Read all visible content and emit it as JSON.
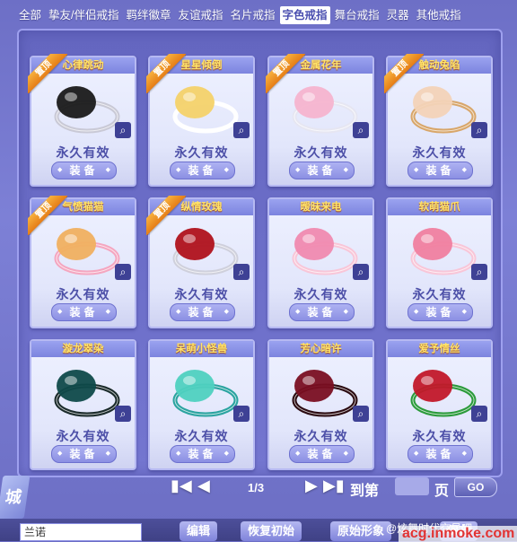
{
  "tabs": [
    {
      "label": "全部",
      "active": false
    },
    {
      "label": "挚友/伴侣戒指",
      "active": false
    },
    {
      "label": "羁绊徽章",
      "active": false
    },
    {
      "label": "友谊戒指",
      "active": false
    },
    {
      "label": "名片戒指",
      "active": false
    },
    {
      "label": "字色戒指",
      "active": true
    },
    {
      "label": "舞台戒指",
      "active": false
    },
    {
      "label": "灵器",
      "active": false
    },
    {
      "label": "其他戒指",
      "active": false
    }
  ],
  "ribbon_label": "置顶",
  "items": [
    {
      "name": "心律跳动",
      "pinned": true,
      "validity": "永久有效",
      "button": "装备",
      "icon": "black-heart-ring-icon",
      "colors": [
        "#1a1a1a",
        "#c9c9d6"
      ]
    },
    {
      "name": "星星倾倒",
      "pinned": true,
      "validity": "永久有效",
      "button": "装备",
      "icon": "golden-star-ring-icon",
      "colors": [
        "#f4d26a",
        "#ffffff"
      ]
    },
    {
      "name": "金属花年",
      "pinned": true,
      "validity": "永久有效",
      "button": "装备",
      "icon": "pink-flower-ring-icon",
      "colors": [
        "#f6b4cf",
        "#e6e6f2"
      ]
    },
    {
      "name": "触动兔陷",
      "pinned": true,
      "validity": "永久有效",
      "button": "装备",
      "icon": "bunny-ring-icon",
      "colors": [
        "#f3d3b8",
        "#d8a66a"
      ]
    },
    {
      "name": "气愤猫猫",
      "pinned": true,
      "validity": "永久有效",
      "button": "装备",
      "icon": "angry-cat-ring-icon",
      "colors": [
        "#f0b060",
        "#f4a6c0"
      ]
    },
    {
      "name": "纵情玫瑰",
      "pinned": true,
      "validity": "永久有效",
      "button": "装备",
      "icon": "rose-ring-icon",
      "colors": [
        "#b0121c",
        "#cfd0dc"
      ]
    },
    {
      "name": "暧昧来电",
      "pinned": false,
      "validity": "永久有效",
      "button": "装备",
      "icon": "pink-heart-ring-icon",
      "colors": [
        "#f08ab0",
        "#f8c6d8"
      ]
    },
    {
      "name": "软萌猫爪",
      "pinned": false,
      "validity": "永久有效",
      "button": "装备",
      "icon": "cat-paw-ring-icon",
      "colors": [
        "#f07fa0",
        "#f8c6d8"
      ]
    },
    {
      "name": "漩龙翠染",
      "pinned": false,
      "validity": "永久有效",
      "button": "装备",
      "icon": "teal-dragon-ring-icon",
      "colors": [
        "#0f4a4a",
        "#1a2a2a"
      ]
    },
    {
      "name": "呆萌小怪兽",
      "pinned": false,
      "validity": "永久有效",
      "button": "装备",
      "icon": "monster-ring-icon",
      "colors": [
        "#4fd1c0",
        "#2aa3a0"
      ]
    },
    {
      "name": "芳心暗许",
      "pinned": false,
      "validity": "永久有效",
      "button": "装备",
      "icon": "crimson-ring-icon",
      "colors": [
        "#7a0f22",
        "#2a0a10"
      ]
    },
    {
      "name": "爱予情丝",
      "pinned": false,
      "validity": "永久有效",
      "button": "装备",
      "icon": "fruit-ring-icon",
      "colors": [
        "#c2182a",
        "#2a9a3a"
      ]
    }
  ],
  "pager": {
    "first": "▮◀",
    "prev": "◀",
    "current": "1/3",
    "next": "▶",
    "last": "▶▮",
    "goto_label": "到第",
    "goto_suffix": "页",
    "go_button": "GO",
    "input_value": ""
  },
  "side_label": "城",
  "bottom": {
    "select_value": "兰诺",
    "buttons": [
      "编辑",
      "恢复初始",
      "原始形象",
      "保存"
    ]
  },
  "watermark": "@炫舞时代交易吧",
  "watermark_site": "acg.inmoke.com"
}
